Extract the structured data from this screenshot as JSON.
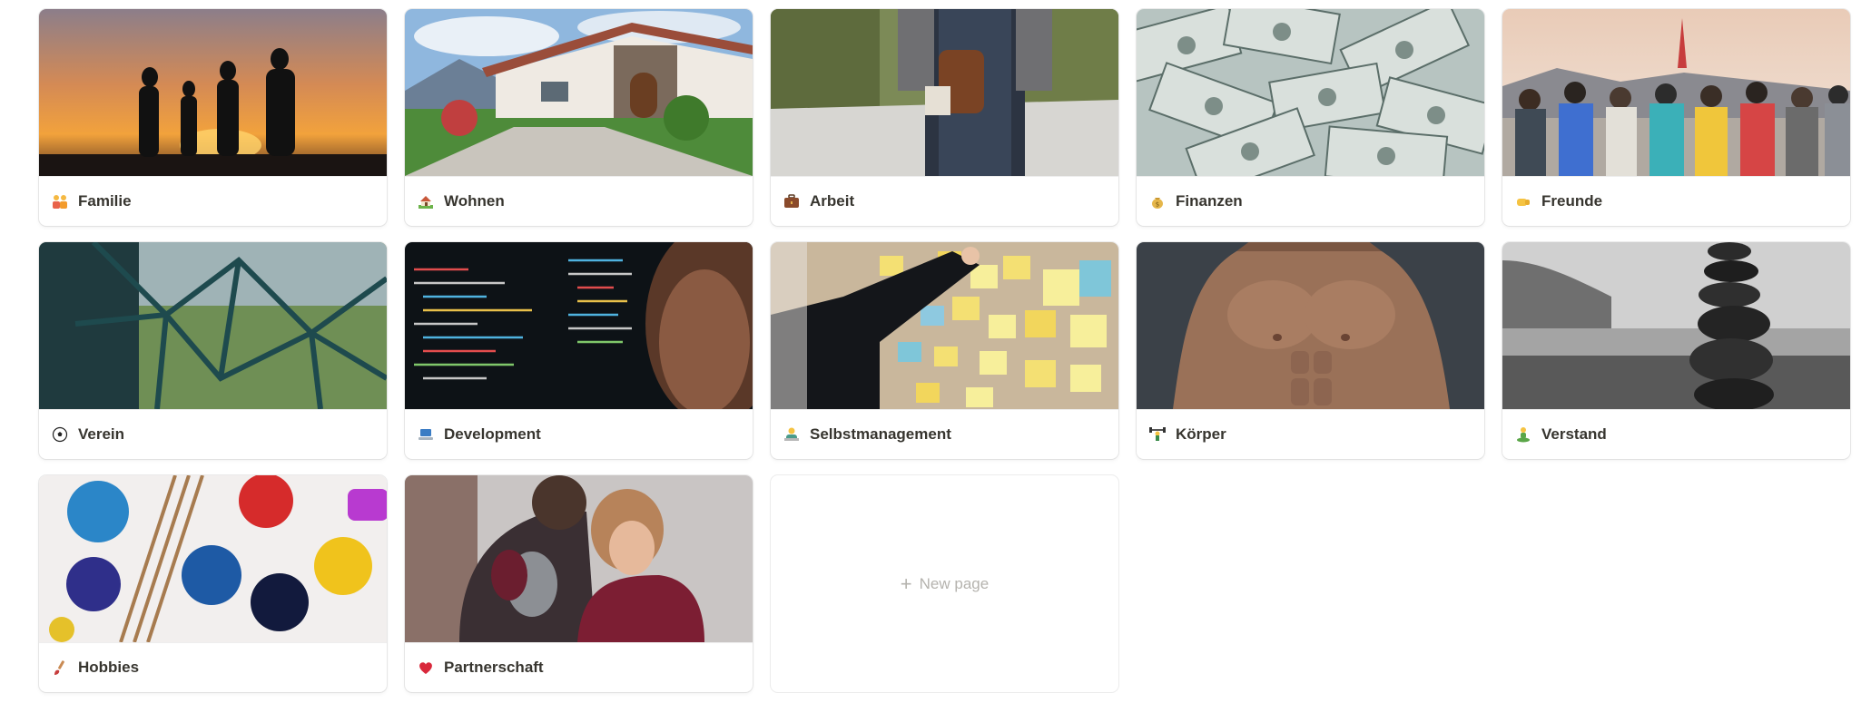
{
  "gallery": {
    "cards": [
      {
        "title": "Familie",
        "icon": "family-emoji-icon",
        "cover": "sunset-family-silhouette"
      },
      {
        "title": "Wohnen",
        "icon": "house-emoji-icon",
        "cover": "house-with-garden"
      },
      {
        "title": "Arbeit",
        "icon": "briefcase-emoji-icon",
        "cover": "man-with-bag"
      },
      {
        "title": "Finanzen",
        "icon": "money-bag-emoji-icon",
        "cover": "dollar-bills"
      },
      {
        "title": "Freunde",
        "icon": "fist-bump-emoji-icon",
        "cover": "friends-arms-around"
      },
      {
        "title": "Verein",
        "icon": "soccer-ball-emoji-icon",
        "cover": "soccer-goal-net"
      },
      {
        "title": "Development",
        "icon": "laptop-emoji-icon",
        "cover": "code-on-screen"
      },
      {
        "title": "Selbstmanagement",
        "icon": "person-at-desk-emoji-icon",
        "cover": "sticky-notes-board"
      },
      {
        "title": "Körper",
        "icon": "weightlifter-emoji-icon",
        "cover": "muscular-torso"
      },
      {
        "title": "Verstand",
        "icon": "meditation-emoji-icon",
        "cover": "stacked-stones"
      },
      {
        "title": "Hobbies",
        "icon": "paintbrush-emoji-icon",
        "cover": "paint-palette"
      },
      {
        "title": "Partnerschaft",
        "icon": "heart-emoji-icon",
        "cover": "couple-hugging"
      }
    ],
    "new_page_label": "New page",
    "new_page_icon": "plus-icon"
  },
  "colors": {
    "title_text": "#37352f",
    "placeholder_text": "#b5b3ae",
    "card_background": "#ffffff"
  }
}
